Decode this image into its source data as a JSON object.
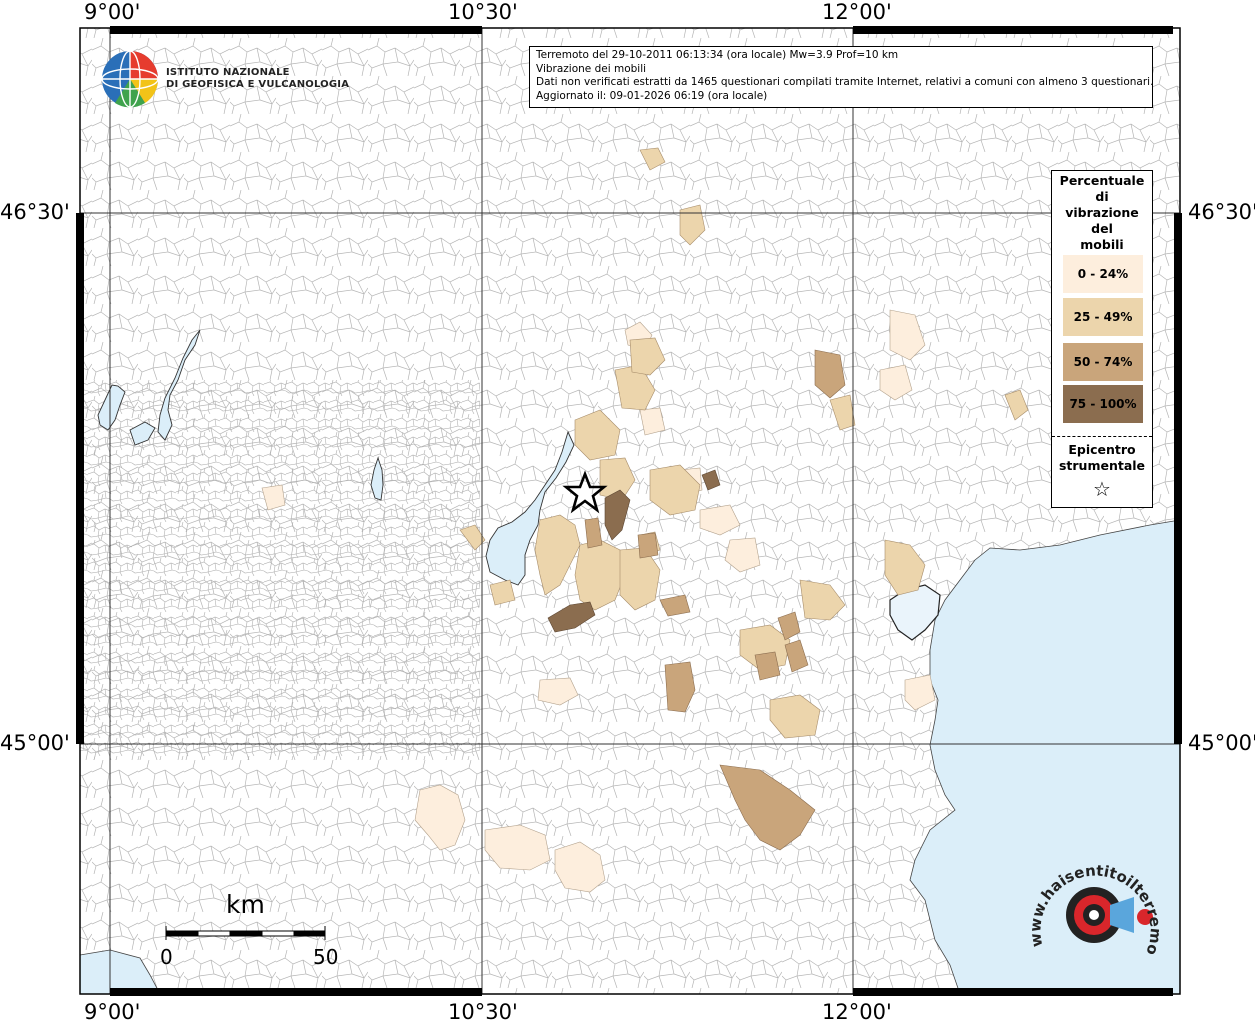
{
  "header": {
    "event_line": "Terremoto del 29-10-2011 06:13:34 (ora locale) Mw=3.9 Prof=10 km",
    "subject_line": "Vibrazione dei mobili",
    "data_line": "Dati non verificati estratti da 1465 questionari compilati tramite Internet, relativi a comuni con almeno 3 questionari.",
    "updated_line": "Aggiornato il: 09-01-2026 06:19 (ora locale)"
  },
  "institute": {
    "line1": "ISTITUTO NAZIONALE",
    "line2": "DI GEOFISICA E VULCANOLOGIA"
  },
  "coordinates": {
    "top": [
      "9°00'",
      "10°30'",
      "12°00'"
    ],
    "bottom": [
      "9°00'",
      "10°30'",
      "12°00'"
    ],
    "left": [
      "46°30'",
      "45°00'"
    ],
    "right": [
      "46°30'",
      "45°00'"
    ]
  },
  "legend": {
    "title": "Percentuale di vibrazione dei mobili",
    "title_lines": [
      "Percentuale",
      "di",
      "vibrazione",
      "del",
      "mobili"
    ],
    "classes": [
      {
        "label": "0 - 24%",
        "color": "#fdeedd"
      },
      {
        "label": "25 - 49%",
        "color": "#ecd5ac"
      },
      {
        "label": "50 - 74%",
        "color": "#c9a57b"
      },
      {
        "label": "75 - 100%",
        "color": "#8b6d4f"
      }
    ],
    "epicenter_title_lines": [
      "Epicentro",
      "strumentale"
    ],
    "epicenter_symbol": "☆"
  },
  "scale_bar": {
    "unit": "km",
    "start": "0",
    "end": "50"
  },
  "logo": {
    "text": "www.haisentitoilterremoto.it"
  },
  "colors": {
    "sea": "#dbeef9",
    "lake": "#dbeef9",
    "border": "#aaaaaa"
  }
}
